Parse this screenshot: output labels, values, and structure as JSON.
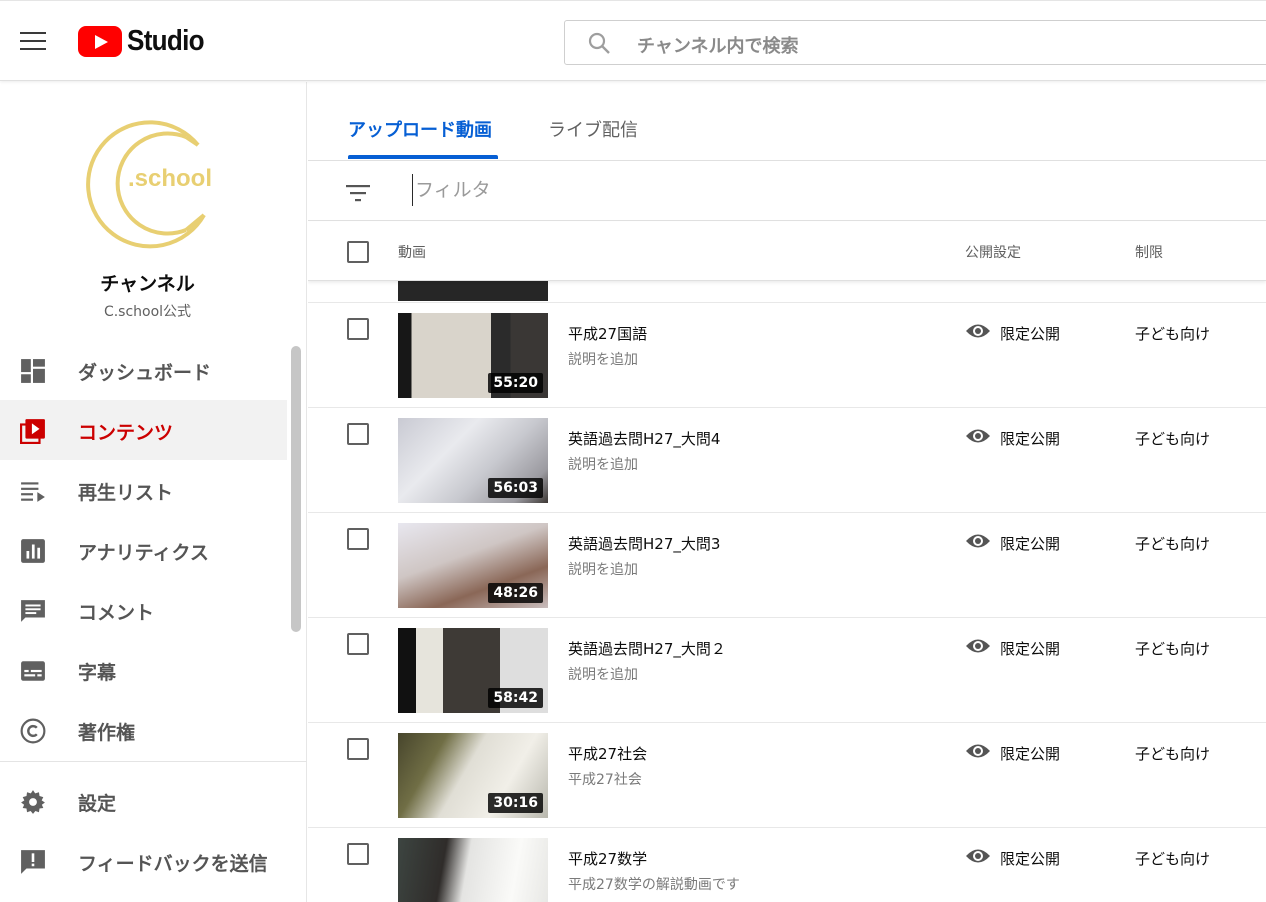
{
  "app": {
    "logo_text": "Studio",
    "menu_icon": "hamburger-menu-icon"
  },
  "search": {
    "placeholder": "チャンネル内で検索"
  },
  "channel": {
    "avatar_text": ".school",
    "title": "チャンネル",
    "subtitle": "C.school公式"
  },
  "sidebar": {
    "items": [
      {
        "label": "ダッシュボード",
        "icon": "dashboard-icon",
        "active": false
      },
      {
        "label": "コンテンツ",
        "icon": "content-icon",
        "active": true
      },
      {
        "label": "再生リスト",
        "icon": "playlist-icon",
        "active": false
      },
      {
        "label": "アナリティクス",
        "icon": "analytics-icon",
        "active": false
      },
      {
        "label": "コメント",
        "icon": "comment-icon",
        "active": false
      },
      {
        "label": "字幕",
        "icon": "subtitles-icon",
        "active": false
      },
      {
        "label": "著作権",
        "icon": "copyright-icon",
        "active": false
      }
    ],
    "bottom_items": [
      {
        "label": "設定",
        "icon": "gear-icon"
      },
      {
        "label": "フィードバックを送信",
        "icon": "feedback-icon"
      }
    ]
  },
  "tabs": [
    {
      "label": "アップロード動画",
      "active": true
    },
    {
      "label": "ライブ配信",
      "active": false
    }
  ],
  "filter": {
    "placeholder": "フィルタ"
  },
  "table": {
    "headers": {
      "video": "動画",
      "visibility": "公開設定",
      "restrictions": "制限"
    },
    "rows": [
      {
        "title": "平成27国語",
        "description": "説明を追加",
        "duration": "55:20",
        "visibility": "限定公開",
        "restriction": "子ども向け"
      },
      {
        "title": "英語過去問H27_大問4",
        "description": "説明を追加",
        "duration": "56:03",
        "visibility": "限定公開",
        "restriction": "子ども向け"
      },
      {
        "title": "英語過去問H27_大問3",
        "description": "説明を追加",
        "duration": "48:26",
        "visibility": "限定公開",
        "restriction": "子ども向け"
      },
      {
        "title": "英語過去問H27_大問２",
        "description": "説明を追加",
        "duration": "58:42",
        "visibility": "限定公開",
        "restriction": "子ども向け"
      },
      {
        "title": "平成27社会",
        "description": "平成27社会",
        "duration": "30:16",
        "visibility": "限定公開",
        "restriction": "子ども向け"
      },
      {
        "title": "平成27数学",
        "description": "平成27数学の解説動画です",
        "duration": "",
        "visibility": "限定公開",
        "restriction": "子ども向け"
      }
    ]
  },
  "colors": {
    "accent_blue": "#065fd4",
    "active_red": "#cc0000",
    "logo_gold": "#e8cf72",
    "youtube_red": "#ff0000"
  }
}
